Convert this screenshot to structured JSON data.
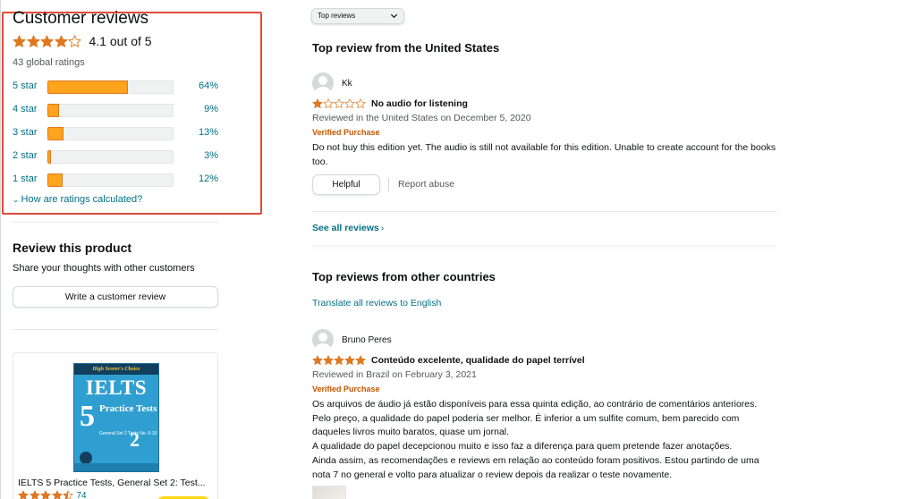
{
  "left": {
    "title": "Customer reviews",
    "avg_rating": 4.1,
    "avg_rating_text": "4.1 out of 5",
    "global_ratings": "43 global ratings",
    "histogram": [
      {
        "label": "5 star",
        "percent": 64,
        "percent_text": "64%"
      },
      {
        "label": "4 star",
        "percent": 9,
        "percent_text": "9%"
      },
      {
        "label": "3 star",
        "percent": 13,
        "percent_text": "13%"
      },
      {
        "label": "2 star",
        "percent": 3,
        "percent_text": "3%"
      },
      {
        "label": "1 star",
        "percent": 12,
        "percent_text": "12%"
      }
    ],
    "how_calculated": "How are ratings calculated?",
    "review_product": {
      "title": "Review this product",
      "subtitle": "Share your thoughts with other customers",
      "button": "Write a customer review"
    },
    "product_card": {
      "cover_top": "High Scorer's Choice",
      "cover_title": "IELTS",
      "cover_number": "5",
      "cover_subtitle": "Practice Tests",
      "cover_set": "General Set 2 Tests No. 6-10",
      "cover_set_number": "2",
      "title": "IELTS 5 Practice Tests, General Set 2: Test...",
      "rating": 4.5,
      "rating_count": "74"
    }
  },
  "right": {
    "sort": {
      "selected": "Top reviews"
    },
    "us_section_title": "Top review from the United States",
    "us_review": {
      "reviewer": "Kk",
      "rating": 1,
      "headline": "No audio for listening",
      "meta": "Reviewed in the United States on December 5, 2020",
      "verified": "Verified Purchase",
      "body": "Do not buy this edition yet. The audio is still not available for this edition. Unable to create account for the books too.",
      "helpful_label": "Helpful",
      "report_label": "Report abuse"
    },
    "see_all": "See all reviews",
    "other_section_title": "Top reviews from other countries",
    "translate_link": "Translate all reviews to English",
    "br_review": {
      "reviewer": "Bruno Peres",
      "rating": 5,
      "headline": "Conteúdo excelente, qualidade do papel terrível",
      "meta": "Reviewed in Brazil on February 3, 2021",
      "verified": "Verified Purchase",
      "body_lines": [
        "Os arquivos de áudio já estão disponíveis para essa quinta edição, ao contrário de comentários anteriores.",
        "Pelo preço, a qualidade do papel poderia ser melhor. É inferior a um sulfite comum, bem parecido com",
        "daqueles livros muito baratos, quase um jornal.",
        "A qualidade do papel decepcionou muito e isso faz a diferença para quem pretende fazer anotações.",
        "Ainda assim, as recomendações e reviews em relação ao conteúdo foram positivos. Estou partindo de uma",
        "nota 7 no general e volto para atualizar o review depois da realizar o teste novamente."
      ]
    }
  },
  "colors": {
    "star": "#de7921",
    "link": "#007185",
    "verified": "#c45500",
    "bar_fill": "#ffa41c",
    "highlight_box": "#e14b3b"
  }
}
